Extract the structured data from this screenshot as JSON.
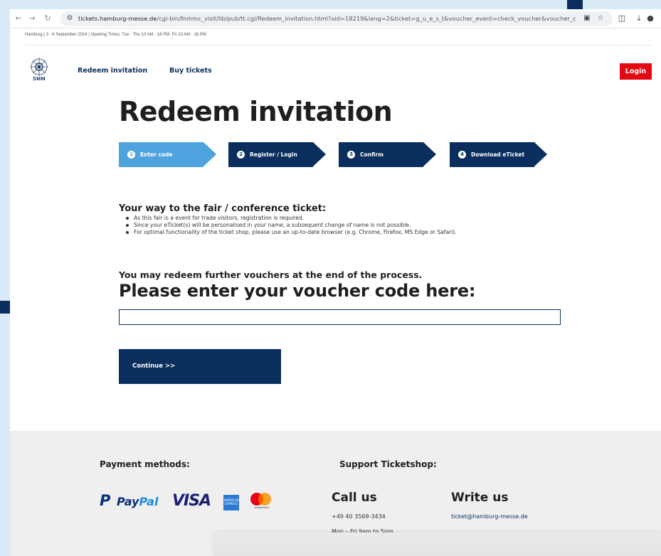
{
  "browser": {
    "url_host": "tickets.hamburg-messe.de",
    "url_path": "/cgi-bin/fmhmc_visit/lib/pub/tt.cgi/Redeem_invitation.html?oid=18219&lang=2&ticket=g_u_e_s_t&voucher_event=check_voucher&voucher_co..."
  },
  "topbar": {
    "info": "Hamburg | 3 - 6 September 2024 | Opening Times: Tue - Thu 10 AM - 18 PM, Fri 10 AM - 16 PM"
  },
  "header": {
    "logo_text": "SMM",
    "nav": [
      "Redeem invitation",
      "Buy tickets"
    ],
    "login_label": "Login"
  },
  "main": {
    "title": "Redeem invitation",
    "steps": [
      {
        "num": "1",
        "label": "Enter code",
        "active": true
      },
      {
        "num": "2",
        "label": "Register / Login",
        "active": false
      },
      {
        "num": "3",
        "label": "Confirm",
        "active": false
      },
      {
        "num": "4",
        "label": "Download eTicket",
        "active": false
      }
    ],
    "info_heading": "Your way to the fair / conference ticket:",
    "info_bullets": [
      "As this fair is a event for trade visitors, registration is required.",
      "Since your eTicket(s) will be personalised in your name, a subsequent change of name is not possible.",
      "For optimal functionality of the ticket shop, please use an up-to-date browser (e.g. Chrome, Firefox, MS Edge or Safari)."
    ],
    "further_vouchers": "You may redeem further vouchers at the end of the process.",
    "voucher_heading": "Please enter your voucher code here:",
    "voucher_value": "",
    "continue_label": "Continue >>"
  },
  "footer": {
    "payment_heading": "Payment methods:",
    "payment_logos": {
      "paypal_pay": "Pay",
      "paypal_pal": "Pal",
      "visa": "VISA",
      "amex": "AMERICAN EXPRESS",
      "mastercard": "mastercard"
    },
    "support_heading": "Support Ticketshop:",
    "call_heading": "Call us",
    "phone": "+49 40 3569-3434",
    "hours": "Mon – Fri 9am to 5pm",
    "write_heading": "Write us",
    "email": "ticket@hamburg-messe.de"
  },
  "colors": {
    "brand_navy": "#0a2f5e",
    "step_active": "#4ea3df",
    "login_red": "#e30613",
    "footer_bg": "#efefef"
  }
}
